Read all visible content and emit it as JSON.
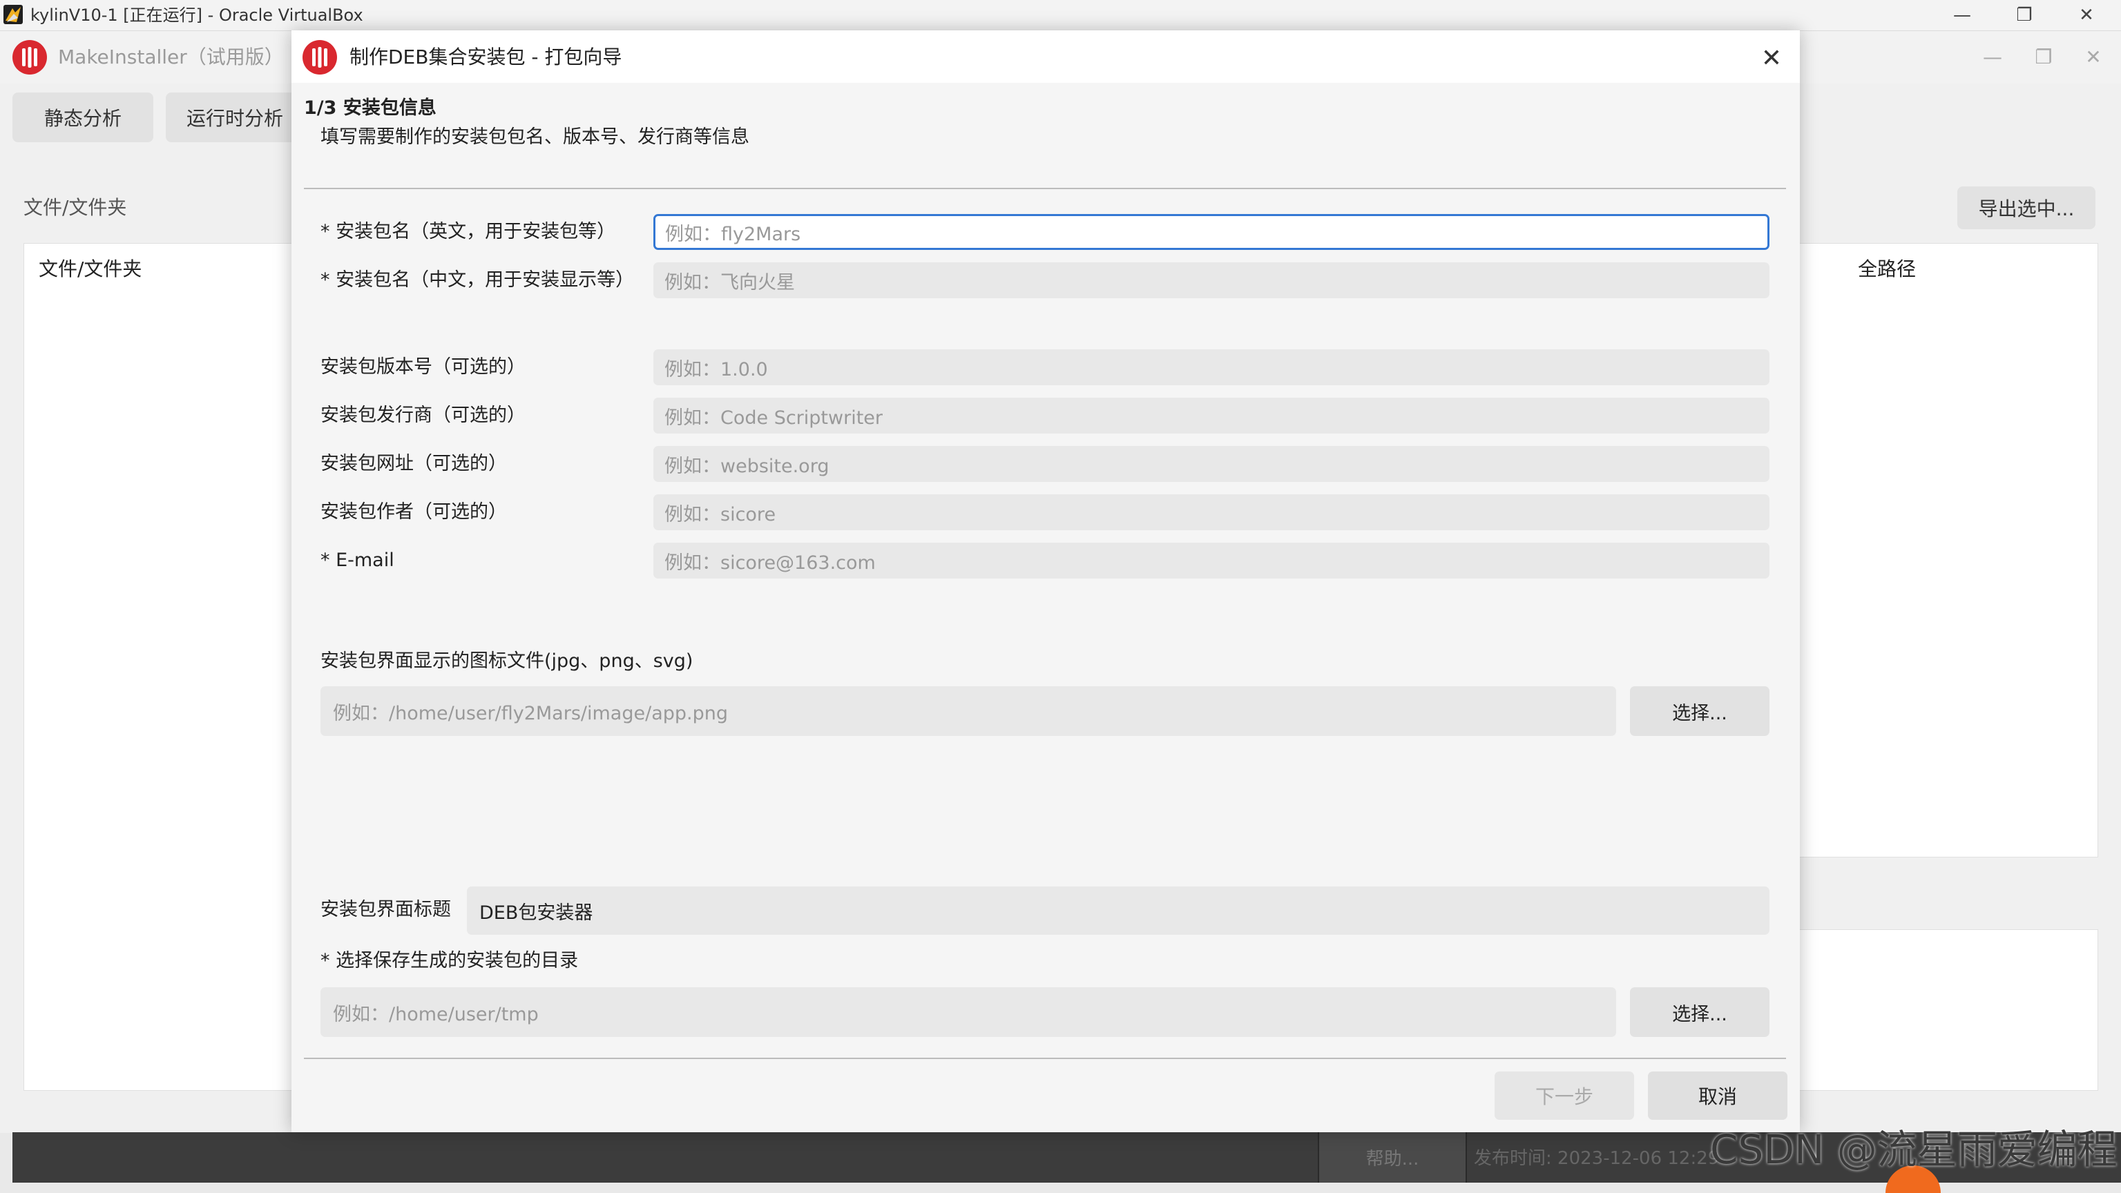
{
  "vbox": {
    "title": "kylinV10-1 [正在运行] - Oracle VirtualBox",
    "minimize": "—",
    "restore": "❐",
    "close": "✕"
  },
  "app": {
    "title": "MakeInstaller（试用版）",
    "minimize": "—",
    "restore": "❐",
    "close": "✕",
    "tabs": [
      "静态分析",
      "运行时分析"
    ],
    "files_label": "文件/文件夹",
    "left_panel_header": "文件/文件夹",
    "export_button": "导出选中...",
    "fullpath_header": "全路径",
    "help_button": "帮助...",
    "release_text": "发布时间: 2023-12-06 12:29",
    "watermark": "CSDN @流星雨爱编程"
  },
  "dialog": {
    "title": "制作DEB集合安装包 - 打包向导",
    "close": "✕",
    "step_title": "1/3 安装包信息",
    "step_desc": "填写需要制作的安装包包名、版本号、发行商等信息",
    "fields": [
      {
        "label": "* 安装包名（英文，用于安装包等）",
        "placeholder": "例如：fly2Mars"
      },
      {
        "label": "* 安装包名（中文，用于安装显示等）",
        "placeholder": "例如：飞向火星"
      },
      {
        "label": "安装包版本号（可选的）",
        "placeholder": "例如：1.0.0"
      },
      {
        "label": "安装包发行商（可选的）",
        "placeholder": "例如：Code Scriptwriter"
      },
      {
        "label": "安装包网址（可选的）",
        "placeholder": "例如：website.org"
      },
      {
        "label": "安装包作者（可选的）",
        "placeholder": "例如：sicore"
      },
      {
        "label": "* E-mail",
        "placeholder": "例如：sicore@163.com"
      }
    ],
    "icon_label": "安装包界面显示的图标文件(jpg、png、svg)",
    "icon_placeholder": "例如：/home/user/fly2Mars/image/app.png",
    "choose_button": "选择...",
    "ui_title_label": "安装包界面标题",
    "ui_title_value": "DEB包安装器",
    "save_dir_label": "* 选择保存生成的安装包的目录",
    "save_dir_placeholder": "例如：/home/user/tmp",
    "next_button": "下一步",
    "cancel_button": "取消"
  }
}
